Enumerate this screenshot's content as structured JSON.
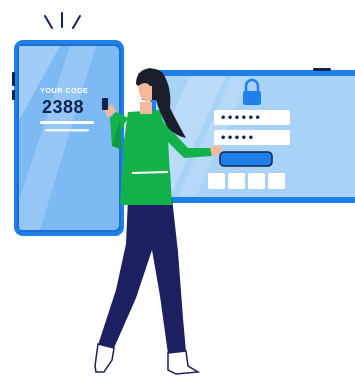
{
  "phone": {
    "code_label": "YOUR CODE",
    "code_value": "2388"
  },
  "login_screen": {
    "username_mask": "••••••",
    "password_mask": "•••••",
    "code_boxes": 4
  },
  "colors": {
    "device_blue": "#1f80ea",
    "screen_light": "#a9d2f7",
    "screen_mid": "#7db9f2",
    "shirt_green": "#12b14a",
    "pants_navy": "#1c2060",
    "hair_dark": "#1b1e2c",
    "skin": "#f2b99b",
    "ink": "#0d2352"
  },
  "icons": [
    "lock-icon",
    "notification-burst-icon"
  ]
}
